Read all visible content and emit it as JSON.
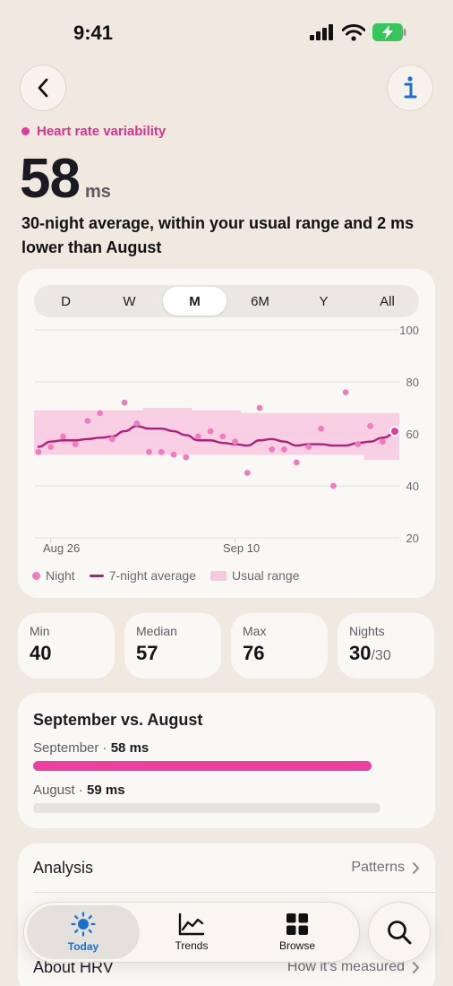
{
  "status": {
    "time": "9:41"
  },
  "metric": {
    "label": "Heart rate variability",
    "value": "58",
    "unit": "ms",
    "summary": "30-night average, within your usual range and 2 ms lower than August"
  },
  "ranges": {
    "options": [
      "D",
      "W",
      "M",
      "6M",
      "Y",
      "All"
    ],
    "selected": "M"
  },
  "chart_data": {
    "type": "scatter",
    "x_tick_labels": [
      "Aug 26",
      "Sep 10"
    ],
    "y_ticks": [
      100,
      80,
      60,
      40,
      20
    ],
    "ylim": [
      20,
      100
    ],
    "xlim": [
      1,
      30
    ],
    "grid": true,
    "series": [
      {
        "name": "Night",
        "type": "scatter",
        "color": "#f07cc0",
        "values": [
          53,
          55,
          59,
          56,
          65,
          68,
          58,
          72,
          64,
          53,
          53,
          52,
          51,
          59,
          61,
          59,
          57,
          45,
          70,
          54,
          54,
          49,
          55,
          62,
          40,
          76,
          56,
          63,
          57,
          61
        ]
      },
      {
        "name": "7-night average",
        "type": "line",
        "color": "#b01e7e",
        "values": [
          55,
          57,
          57.5,
          57.5,
          58,
          58.5,
          59,
          61,
          63,
          62,
          62,
          61,
          59.5,
          57.5,
          57.5,
          56.5,
          56,
          55.5,
          57.5,
          58,
          57,
          55.5,
          56,
          56,
          55.5,
          55.5,
          56.5,
          57,
          58.5,
          60
        ]
      },
      {
        "name": "Usual range",
        "type": "band",
        "color": "#f8c8e1",
        "low": [
          52,
          52,
          52,
          52,
          52,
          52,
          52,
          52,
          52,
          52,
          52,
          52,
          52,
          52,
          52,
          52,
          52,
          52,
          52,
          52,
          52,
          52,
          52,
          52,
          52,
          52,
          52,
          50,
          50,
          50
        ],
        "high": [
          69,
          69,
          69,
          69,
          69,
          69,
          69,
          69,
          69,
          70,
          70,
          70,
          70,
          69,
          69,
          69,
          69,
          68,
          68,
          68,
          68,
          68,
          68,
          68,
          68,
          68,
          68,
          68,
          68,
          68
        ]
      }
    ]
  },
  "legend": {
    "night": "Night",
    "average": "7-night average",
    "range": "Usual range"
  },
  "stats": [
    {
      "label": "Min",
      "value": "40",
      "sub": ""
    },
    {
      "label": "Median",
      "value": "57",
      "sub": ""
    },
    {
      "label": "Max",
      "value": "76",
      "sub": ""
    },
    {
      "label": "Nights",
      "value": "30",
      "sub": "/30"
    }
  ],
  "comparison": {
    "title": "September vs. August",
    "current": {
      "label": "September",
      "value": "58 ms",
      "fraction": 0.98
    },
    "previous": {
      "label": "August",
      "value": "59 ms",
      "fraction": 1.0
    }
  },
  "list": [
    {
      "title": "Analysis",
      "detail": "Patterns"
    },
    {
      "title": "About HRV",
      "detail": "How it's measured"
    }
  ],
  "tabs": [
    {
      "label": "Today",
      "icon": "sun-icon",
      "active": true
    },
    {
      "label": "Trends",
      "icon": "chart-icon",
      "active": false
    },
    {
      "label": "Browse",
      "icon": "grid-icon",
      "active": false
    }
  ],
  "colors": {
    "accent": "#e2399a",
    "tab_active": "#1b6fd1",
    "background": "#efe9df"
  }
}
